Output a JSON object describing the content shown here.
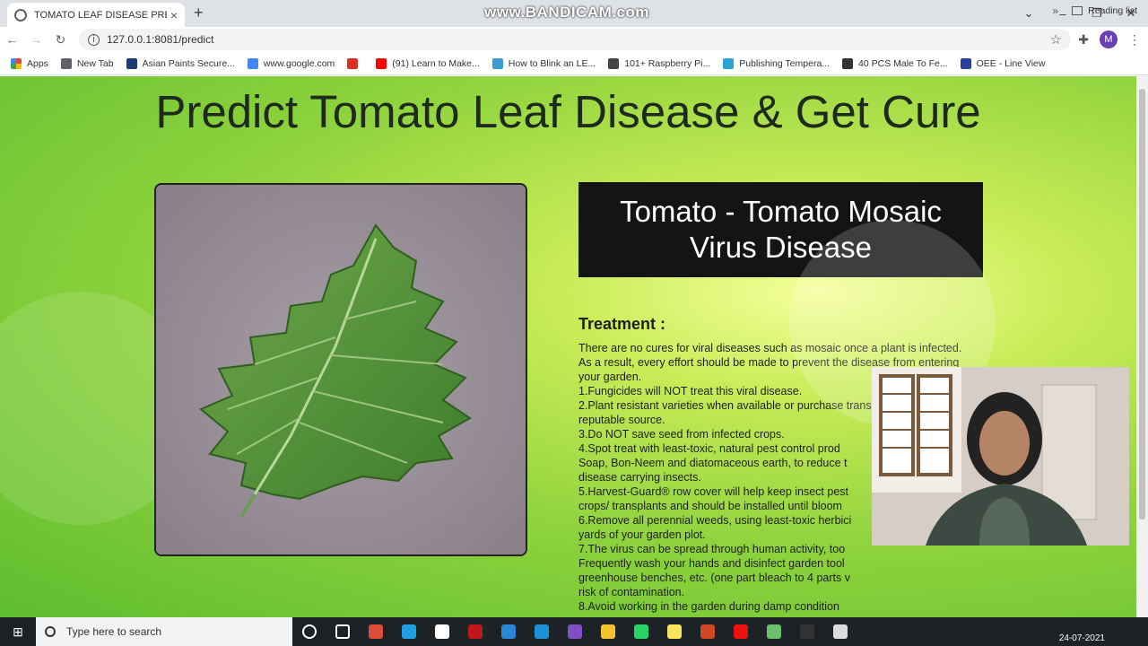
{
  "browser": {
    "tab_title": "TOMATO LEAF DISEASE PREDICT",
    "tab_close": "×",
    "new_tab": "+",
    "watermark": "www.BANDICAM.com",
    "url": "127.0.0.1:8081/predict",
    "profile_initial": "M",
    "bookmarks": [
      {
        "label": "Apps",
        "color": "#e8453c"
      },
      {
        "label": "New Tab",
        "color": "#5f6368"
      },
      {
        "label": "Asian Paints Secure...",
        "color": "#1c3c78"
      },
      {
        "label": "www.google.com",
        "color": "#4285f4"
      },
      {
        "label": "",
        "color": "#d93025"
      },
      {
        "label": "(91) Learn to Make...",
        "color": "#ff0000"
      },
      {
        "label": "How to Blink an LE...",
        "color": "#3a9bd5"
      },
      {
        "label": "101+ Raspberry Pi...",
        "color": "#444444"
      },
      {
        "label": "Publishing Tempera...",
        "color": "#2aa3d8"
      },
      {
        "label": "40 PCS Male To Fe...",
        "color": "#333333"
      },
      {
        "label": "OEE - Line View",
        "color": "#2b3f9e"
      }
    ],
    "reading_list": "Reading list",
    "chevron": "»"
  },
  "page": {
    "headline": "Predict Tomato Leaf Disease & Get Cure",
    "prediction": "Tomato - Tomato Mosaic Virus Disease",
    "treatment_heading": "Treatment :",
    "treatment_lines": [
      "There are no cures for viral diseases such as mosaic once a plant is infected. As a result, every effort should be made to prevent the disease from entering your garden.",
      "1.Fungicides will NOT treat this viral disease.",
      "2.Plant resistant varieties when available or purchase transplants from a reputable source.",
      "3.Do NOT save seed from infected crops.",
      "4.Spot treat with least-toxic, natural pest control prod",
      "Soap, Bon-Neem and diatomaceous earth, to reduce t",
      "disease carrying insects.",
      "5.Harvest-Guard® row cover will help keep insect pest",
      "crops/ transplants and should be installed until bloom",
      "6.Remove all perennial weeds, using least-toxic herbici",
      "yards of your garden plot.",
      "7.The virus can be spread through human activity, too",
      "Frequently wash your hands and disinfect garden tool",
      "greenhouse benches, etc. (one part bleach to 4 parts v",
      "risk of contamination.",
      "8.Avoid working in the garden during damp condition"
    ],
    "colors": {
      "background_green": "#8fd33d",
      "prediction_box": "#141414"
    }
  },
  "taskbar": {
    "search_placeholder": "Type here to search",
    "date": "24-07-2021",
    "apps": [
      "cortana-icon",
      "task-view-icon",
      "chrome-icon",
      "edge-icon",
      "store-icon",
      "mcafee-icon",
      "mail-icon",
      "vscode-icon",
      "visual-studio-icon",
      "file-explorer-icon",
      "whatsapp-icon",
      "sticky-notes-icon",
      "powerpoint-icon",
      "record-icon",
      "notepad-icon",
      "terminal-icon",
      "document-icon"
    ]
  }
}
